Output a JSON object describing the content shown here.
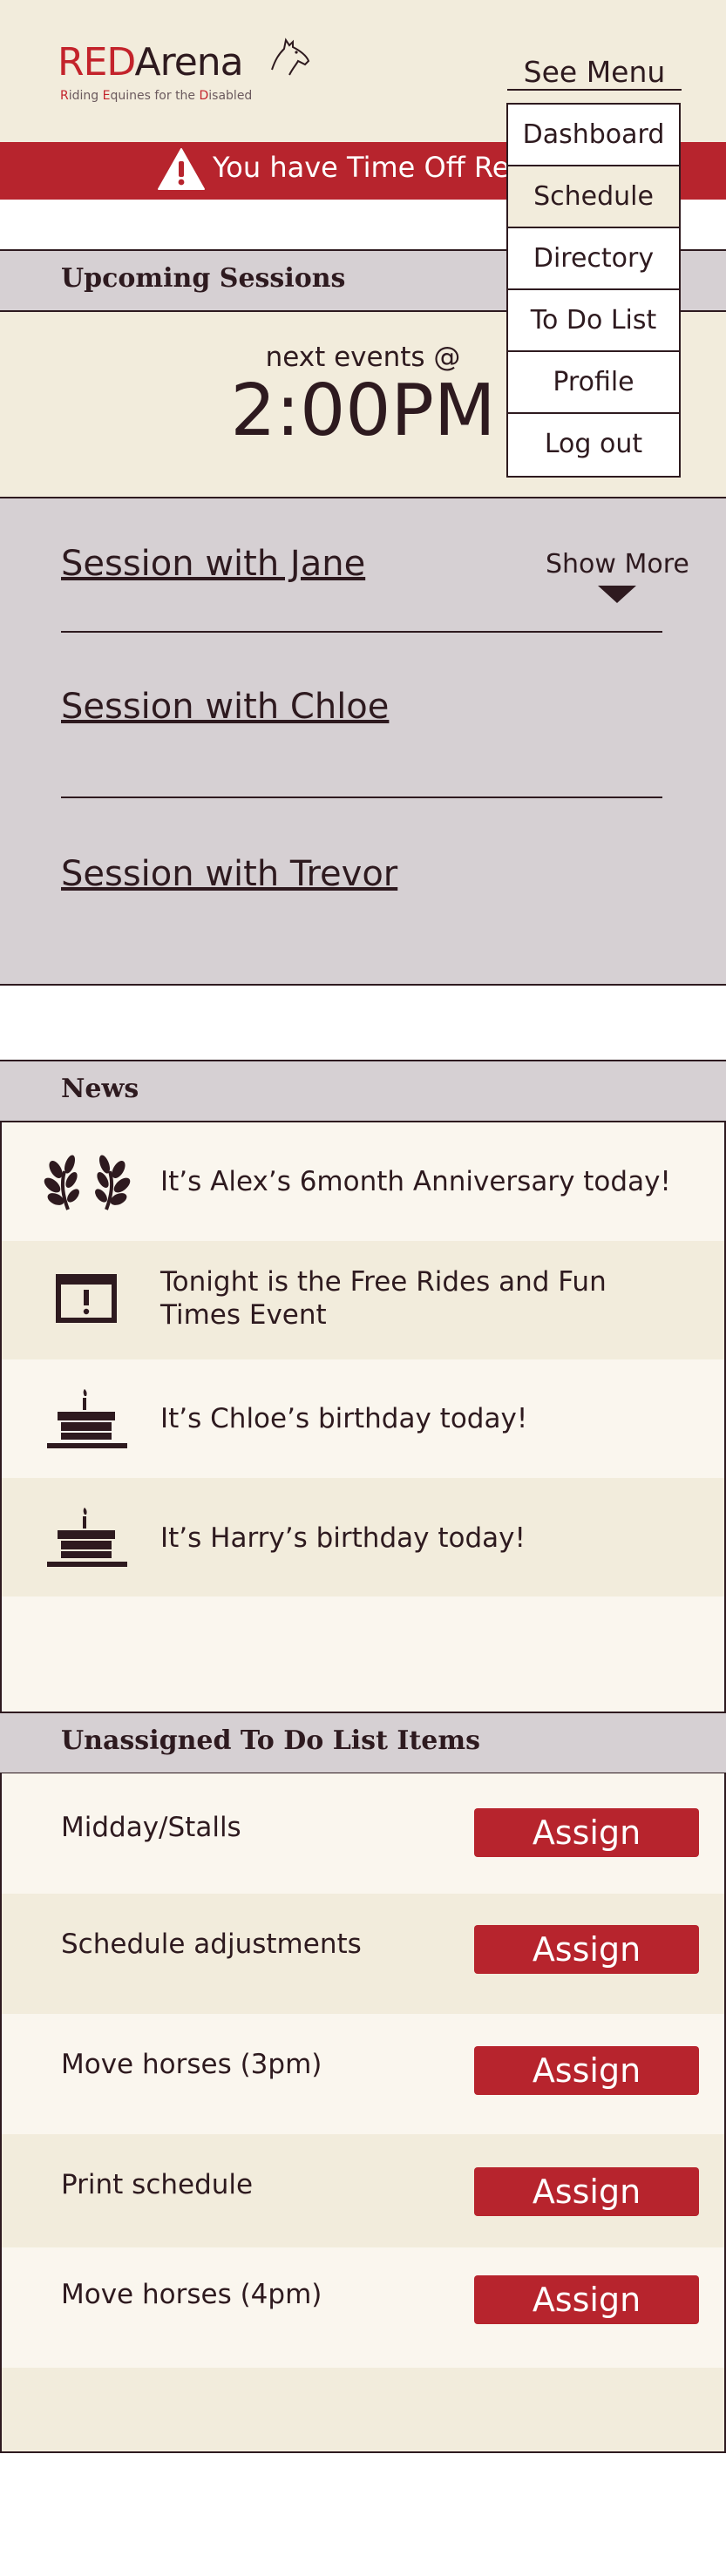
{
  "brand": {
    "logo_red": "RED",
    "logo_dark": "Arena",
    "tagline_parts": [
      "R",
      "iding ",
      "E",
      "quines for the ",
      "D",
      "isabled"
    ]
  },
  "menu": {
    "toggle_label": "See Menu",
    "items": [
      {
        "label": "Dashboard"
      },
      {
        "label": "Schedule"
      },
      {
        "label": "Directory"
      },
      {
        "label": "To Do List"
      },
      {
        "label": "Profile"
      },
      {
        "label": "Log out"
      }
    ],
    "active_index": 1
  },
  "alert": {
    "text": "You have Time Off Rec"
  },
  "upcoming": {
    "title": "Upcoming Sessions",
    "next_label": "next events @",
    "next_time": "2:00PM",
    "show_more": "Show More",
    "sessions": [
      {
        "label": "Session with Jane"
      },
      {
        "label": "Session with Chloe"
      },
      {
        "label": "Session with Trevor"
      }
    ]
  },
  "news": {
    "title": "News",
    "items": [
      {
        "icon": "laurel-icon",
        "text": "It’s Alex’s 6month Anniversary today!"
      },
      {
        "icon": "calendar-alert-icon",
        "text": "Tonight is the Free Rides and Fun Times Event"
      },
      {
        "icon": "birthday-cake-icon",
        "text": "It’s Chloe’s birthday today!"
      },
      {
        "icon": "birthday-cake-icon",
        "text": "It’s Harry’s birthday today!"
      }
    ]
  },
  "todo": {
    "title": "Unassigned To Do List Items",
    "assign_label": "Assign",
    "items": [
      {
        "label": "Midday/Stalls"
      },
      {
        "label": "Schedule adjustments"
      },
      {
        "label": "Move horses (3pm)"
      },
      {
        "label": "Print schedule"
      },
      {
        "label": "Move horses (4pm)"
      }
    ]
  },
  "colors": {
    "brand_red": "#b7242d",
    "cream": "#f2ecdc",
    "light_cream": "#faf6ee",
    "header_gray": "#d6d0d3",
    "ink": "#2e1a1f"
  }
}
